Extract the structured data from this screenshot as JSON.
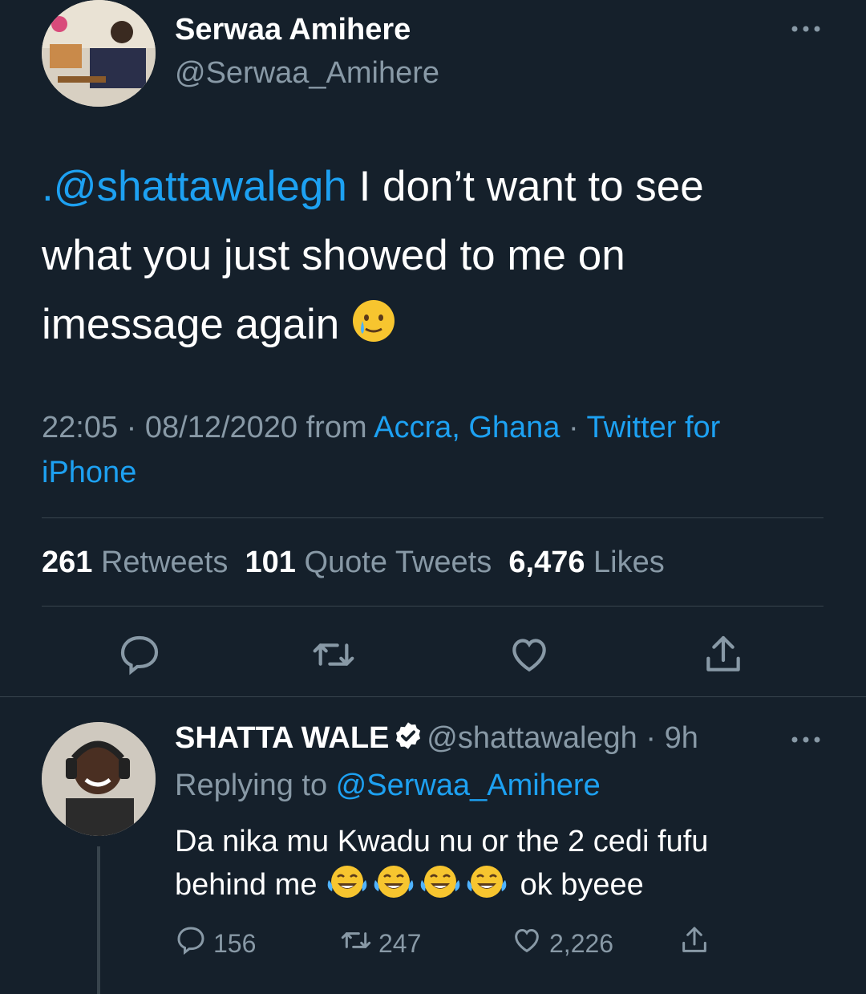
{
  "tweet": {
    "author_name": "Serwaa Amihere",
    "author_handle": "@Serwaa_Amihere",
    "more_icon": "more-icon",
    "text_mention": ".@shattawalegh",
    "text_body_1": " I don’t want to see",
    "text_body_2": "what you just showed to me on",
    "text_body_3": "imessage again ",
    "emoji": "crying-smile-face",
    "time": "22:05",
    "sep1": " · ",
    "date": "08/12/2020",
    "from": " from ",
    "location": "Accra, Ghana",
    "sep2": " · ",
    "client_1": "Twitter for",
    "client_2": "iPhone",
    "stats": {
      "retweets_count": "261",
      "retweets_label": "Retweets",
      "quotes_count": "101",
      "quotes_label": "Quote Tweets",
      "likes_count": "6,476",
      "likes_label": "Likes"
    },
    "actions": [
      "reply-icon",
      "retweet-icon",
      "like-icon",
      "share-icon"
    ]
  },
  "reply": {
    "author_name": "SHATTA WALE",
    "verified_icon": "verified-badge-icon",
    "author_handle": "@shattawalegh",
    "sep": " · ",
    "time": "9h",
    "replying_label": "Replying to ",
    "replying_handle": "@Serwaa_Amihere",
    "text_1": "Da nika  mu Kwadu nu or the 2 cedi fufu",
    "text_2_start": "behind me ",
    "emoji": "tears-of-joy-face",
    "emoji_count": 4,
    "text_2_end": " ok byeee",
    "replies": "156",
    "retweets": "247",
    "likes": "2,226"
  },
  "colors": {
    "background": "#15202b",
    "accent": "#1da1f2",
    "secondary_text": "#8899a6",
    "divider": "#38444d"
  }
}
